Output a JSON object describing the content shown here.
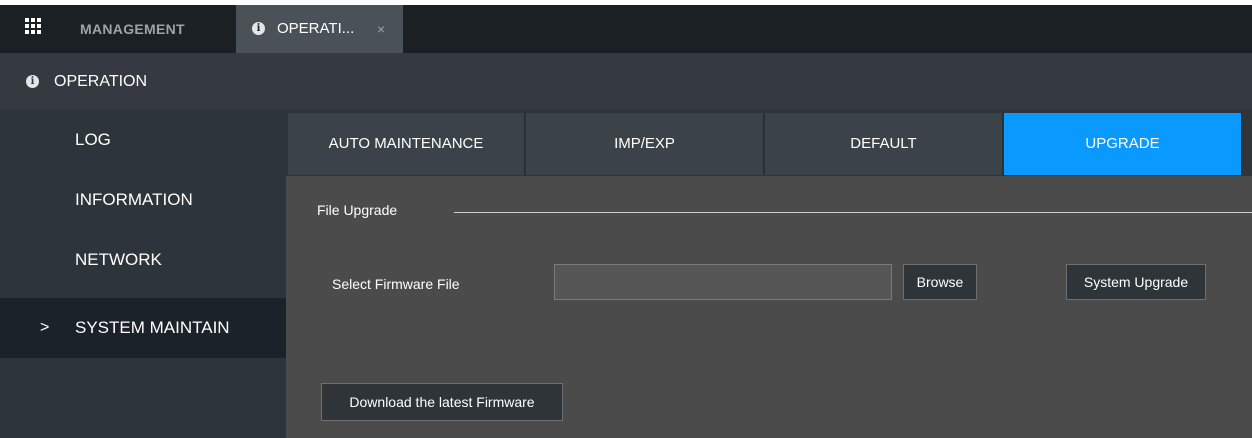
{
  "topbar": {
    "menu_icon": "grid-icon",
    "management_label": "MANAGEMENT",
    "active_tab": {
      "icon": "info-icon",
      "label": "OPERATI...",
      "close": "×"
    }
  },
  "header": {
    "icon": "info-icon",
    "title": "OPERATION"
  },
  "sidebar": {
    "items": [
      {
        "label": "LOG",
        "active": false
      },
      {
        "label": "INFORMATION",
        "active": false
      },
      {
        "label": "NETWORK",
        "active": false
      },
      {
        "label": "SYSTEM MAINTAIN",
        "active": true,
        "indicator": ">"
      }
    ]
  },
  "tabs": [
    {
      "label": "AUTO MAINTENANCE",
      "active": false
    },
    {
      "label": "IMP/EXP",
      "active": false
    },
    {
      "label": "DEFAULT",
      "active": false
    },
    {
      "label": "UPGRADE",
      "active": true
    }
  ],
  "file_upgrade": {
    "section_title": "File Upgrade",
    "select_label": "Select Firmware File",
    "file_value": "",
    "browse_label": "Browse",
    "system_upgrade_label": "System Upgrade",
    "download_label": "Download the latest Firmware"
  },
  "colors": {
    "accent": "#0a99ff",
    "topbar_bg": "#1b2024",
    "header_bg": "#343a3f",
    "sidebar_bg": "#2e353a",
    "content_bg": "#4b4b4b"
  }
}
